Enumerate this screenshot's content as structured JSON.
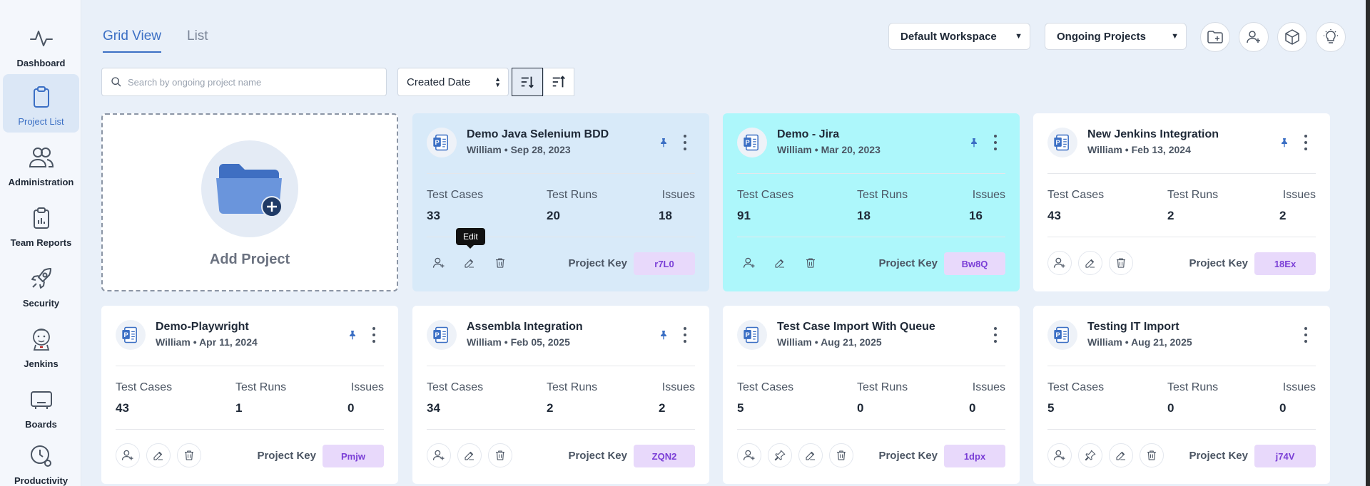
{
  "sidebar": {
    "items": [
      {
        "label": "Dashboard",
        "icon": "activity-icon"
      },
      {
        "label": "Project List",
        "icon": "clipboard-icon",
        "active": true
      },
      {
        "label": "Administration",
        "icon": "users-icon"
      },
      {
        "label": "Team Reports",
        "icon": "report-icon"
      },
      {
        "label": "Security",
        "icon": "rocket-icon"
      },
      {
        "label": "Jenkins",
        "icon": "jenkins-icon"
      },
      {
        "label": "Boards",
        "icon": "board-icon"
      },
      {
        "label": "Productivity",
        "icon": "clock-gear-icon"
      }
    ]
  },
  "tabs": [
    {
      "label": "Grid View",
      "active": true
    },
    {
      "label": "List",
      "active": false
    }
  ],
  "workspace_select": {
    "value": "Default Workspace"
  },
  "status_select": {
    "value": "Ongoing Projects"
  },
  "search": {
    "placeholder": "Search by ongoing project name"
  },
  "sort": {
    "value": "Created Date"
  },
  "add_project": {
    "label": "Add Project"
  },
  "tooltip": {
    "text": "Edit"
  },
  "labels": {
    "test_cases": "Test Cases",
    "test_runs": "Test Runs",
    "issues": "Issues",
    "project_key": "Project Key"
  },
  "colors": {
    "accent": "#3b6fc4",
    "highlight_card": "#adf7fb",
    "hover_card": "#d8eaf9",
    "key_badge_bg": "#e8d9fb",
    "key_badge_text": "#7a3ed6"
  },
  "projects": [
    {
      "name": "Demo Java Selenium BDD",
      "owner": "William",
      "date": "Sep 28, 2023",
      "test_cases": "33",
      "test_runs": "20",
      "issues": "18",
      "key": "r7L0",
      "pinned": true
    },
    {
      "name": "Demo - Jira",
      "owner": "William",
      "date": "Mar 20, 2023",
      "test_cases": "91",
      "test_runs": "18",
      "issues": "16",
      "key": "Bw8Q",
      "pinned": true
    },
    {
      "name": "New Jenkins Integration",
      "owner": "William",
      "date": "Feb 13, 2024",
      "test_cases": "43",
      "test_runs": "2",
      "issues": "2",
      "key": "18Ex",
      "pinned": true
    },
    {
      "name": "Demo-Playwright",
      "owner": "William",
      "date": "Apr 11, 2024",
      "test_cases": "43",
      "test_runs": "1",
      "issues": "0",
      "key": "Pmjw",
      "pinned": true
    },
    {
      "name": "Assembla Integration",
      "owner": "William",
      "date": "Feb 05, 2025",
      "test_cases": "34",
      "test_runs": "2",
      "issues": "2",
      "key": "ZQN2",
      "pinned": true
    },
    {
      "name": "Test Case Import With Queue",
      "owner": "William",
      "date": "Aug 21, 2025",
      "test_cases": "5",
      "test_runs": "0",
      "issues": "0",
      "key": "1dpx",
      "pinned": false
    },
    {
      "name": "Testing IT Import",
      "owner": "William",
      "date": "Aug 21, 2025",
      "test_cases": "5",
      "test_runs": "0",
      "issues": "0",
      "key": "j74V",
      "pinned": false
    }
  ]
}
